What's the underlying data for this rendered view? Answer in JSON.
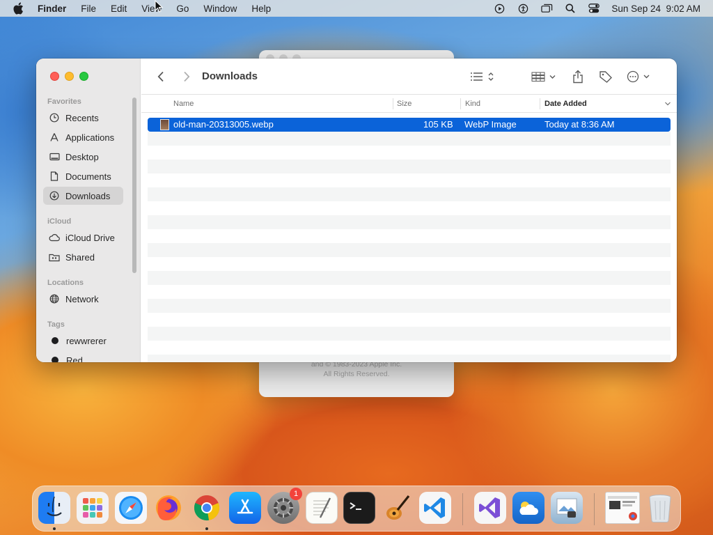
{
  "menubar": {
    "app_name": "Finder",
    "menus": [
      "File",
      "Edit",
      "View",
      "Go",
      "Window",
      "Help"
    ],
    "datetime": "Sun Sep 24  9:02 AM",
    "status_icons": [
      "screen-record-icon",
      "accessibility-icon",
      "screen-mirroring-icon",
      "spotlight-icon",
      "control-center-icon"
    ]
  },
  "background_window": {
    "copyright_line1": "and © 1983-2023 Apple Inc.",
    "copyright_line2": "All Rights Reserved."
  },
  "finder": {
    "title": "Downloads",
    "sidebar": {
      "favorites_title": "Favorites",
      "favorites": [
        {
          "label": "Recents",
          "icon": "clock-icon"
        },
        {
          "label": "Applications",
          "icon": "applications-icon"
        },
        {
          "label": "Desktop",
          "icon": "desktop-icon"
        },
        {
          "label": "Documents",
          "icon": "document-icon"
        },
        {
          "label": "Downloads",
          "icon": "download-icon",
          "active": true
        }
      ],
      "icloud_title": "iCloud",
      "icloud": [
        {
          "label": "iCloud Drive",
          "icon": "cloud-icon"
        },
        {
          "label": "Shared",
          "icon": "shared-folder-icon"
        }
      ],
      "locations_title": "Locations",
      "locations": [
        {
          "label": "Network",
          "icon": "globe-icon"
        }
      ],
      "tags_title": "Tags",
      "tags": [
        {
          "label": "rewwrerer",
          "color": "#1d1d1f"
        },
        {
          "label": "Red",
          "color": "#1d1d1f"
        }
      ]
    },
    "columns": {
      "name": "Name",
      "size": "Size",
      "kind": "Kind",
      "date_added": "Date Added"
    },
    "files": [
      {
        "name": "old-man-20313005.webp",
        "size": "105 KB",
        "kind": "WebP Image",
        "date_added": "Today at 8:36 AM",
        "selected": true
      }
    ]
  },
  "dock": {
    "apps": [
      "Finder",
      "Launchpad",
      "Safari",
      "Firefox",
      "Google Chrome",
      "App Store",
      "System Settings",
      "TextEdit",
      "Terminal",
      "GarageBand",
      "Visual Studio Code",
      "Visual Studio",
      "Weather",
      "Preview",
      "Chrome Window",
      "Trash"
    ],
    "settings_badge": "1"
  },
  "colors": {
    "selection": "#0b63d9",
    "close": "#ff5f57",
    "minimize": "#febc2e",
    "maximize": "#28c840"
  }
}
